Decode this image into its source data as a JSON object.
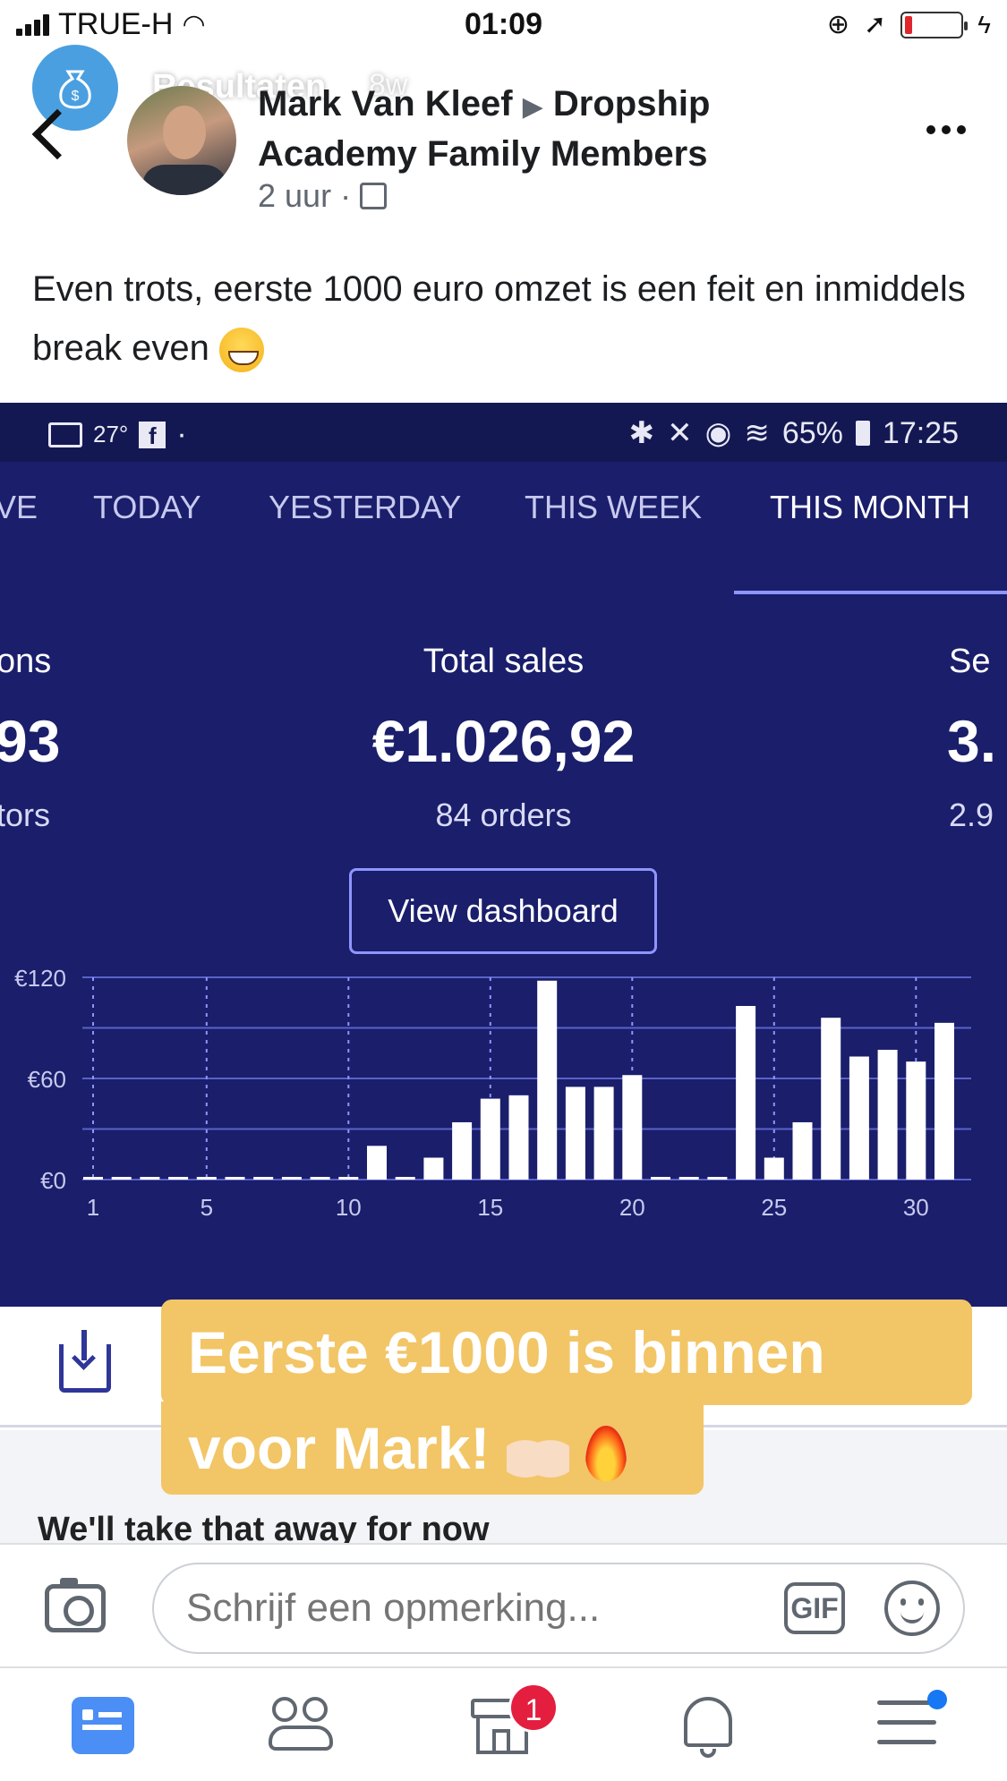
{
  "status_bar": {
    "carrier": "TRUE-H",
    "time": "01:09"
  },
  "story": {
    "title": "Resultaten",
    "age": "8w"
  },
  "post": {
    "author": "Mark Van Kleef",
    "group": "Dropship Academy Family Members",
    "time": "2 uur",
    "text": "Even trots, eerste 1000 euro omzet is een feit en inmiddels break even"
  },
  "screenshot": {
    "status": {
      "temp": "27°",
      "battery": "65%",
      "time": "17:25"
    },
    "tabs": [
      "VE",
      "TODAY",
      "YESTERDAY",
      "THIS WEEK",
      "THIS MONTH"
    ],
    "active_tab": "THIS MONTH",
    "left_col": {
      "label": "ons",
      "value": "93",
      "sub": "tors"
    },
    "total_sales": {
      "label": "Total sales",
      "value": "€1.026,92",
      "orders": "84 orders"
    },
    "right_col": {
      "label": "Se",
      "value": "3.",
      "sub": "2.9"
    },
    "view_dashboard": "View dashboard"
  },
  "chart_data": {
    "type": "bar",
    "x_ticks": [
      "1",
      "5",
      "10",
      "15",
      "20",
      "25",
      "30"
    ],
    "y_ticks": [
      "€0",
      "€60",
      "€120"
    ],
    "ylim": [
      0,
      120
    ],
    "categories": [
      1,
      2,
      3,
      4,
      5,
      6,
      7,
      8,
      9,
      10,
      11,
      12,
      13,
      14,
      15,
      16,
      17,
      18,
      19,
      20,
      21,
      22,
      23,
      24,
      25,
      26,
      27,
      28,
      29,
      30,
      31
    ],
    "values": [
      0,
      0,
      0,
      0,
      0,
      0,
      0,
      0,
      0,
      0,
      20,
      0,
      13,
      34,
      48,
      50,
      118,
      55,
      55,
      62,
      0,
      0,
      0,
      103,
      13,
      34,
      96,
      73,
      77,
      70,
      93
    ],
    "bar_color": "#ffffff",
    "grid": true
  },
  "sticker": {
    "line1": "Eerste €1000 is binnen",
    "line2": "voor Mark!"
  },
  "content": {
    "cut_text": "We'll take that away for now"
  },
  "comment": {
    "placeholder": "Schrijf een opmerking...",
    "gif": "GIF"
  },
  "nav": {
    "marketplace_badge": "1"
  }
}
